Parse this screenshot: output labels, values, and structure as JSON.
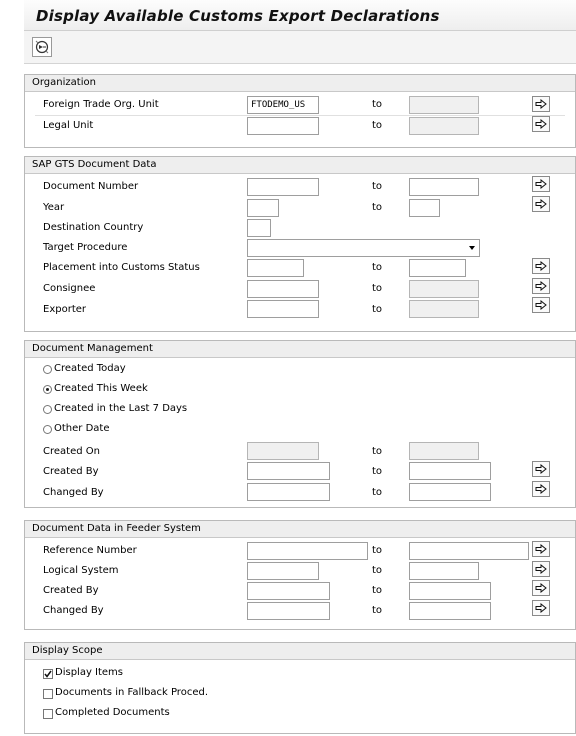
{
  "window": {
    "title": "Display Available Customs Export Declarations"
  },
  "toolbar": {
    "execute_icon": "execute-icon"
  },
  "organization": {
    "title": "Organization",
    "fto_label": "Foreign Trade Org. Unit",
    "fto_value": "FTODEMO_US",
    "legal_label": "Legal Unit",
    "to": "to"
  },
  "gts": {
    "title": "SAP GTS Document Data",
    "doc_number": "Document Number",
    "year": "Year",
    "dest_country": "Destination Country",
    "target_proc": "Target Procedure",
    "placement": "Placement into Customs Status",
    "consignee": "Consignee",
    "exporter": "Exporter",
    "to": "to"
  },
  "mgmt": {
    "title": "Document Management",
    "radios": [
      "Created Today",
      "Created This Week",
      "Created in the Last 7 Days",
      "Other Date"
    ],
    "selected_radio": 1,
    "created_on": "Created On",
    "created_by": "Created By",
    "changed_by": "Changed By",
    "to": "to"
  },
  "feeder": {
    "title": "Document Data in Feeder System",
    "ref_number": "Reference Number",
    "logical_system": "Logical System",
    "created_by": "Created By",
    "changed_by": "Changed By",
    "to": "to"
  },
  "scope": {
    "title": "Display Scope",
    "checks": [
      "Display Items",
      "Documents in Fallback Proced.",
      "Completed Documents"
    ],
    "checked": [
      true,
      false,
      false
    ]
  }
}
